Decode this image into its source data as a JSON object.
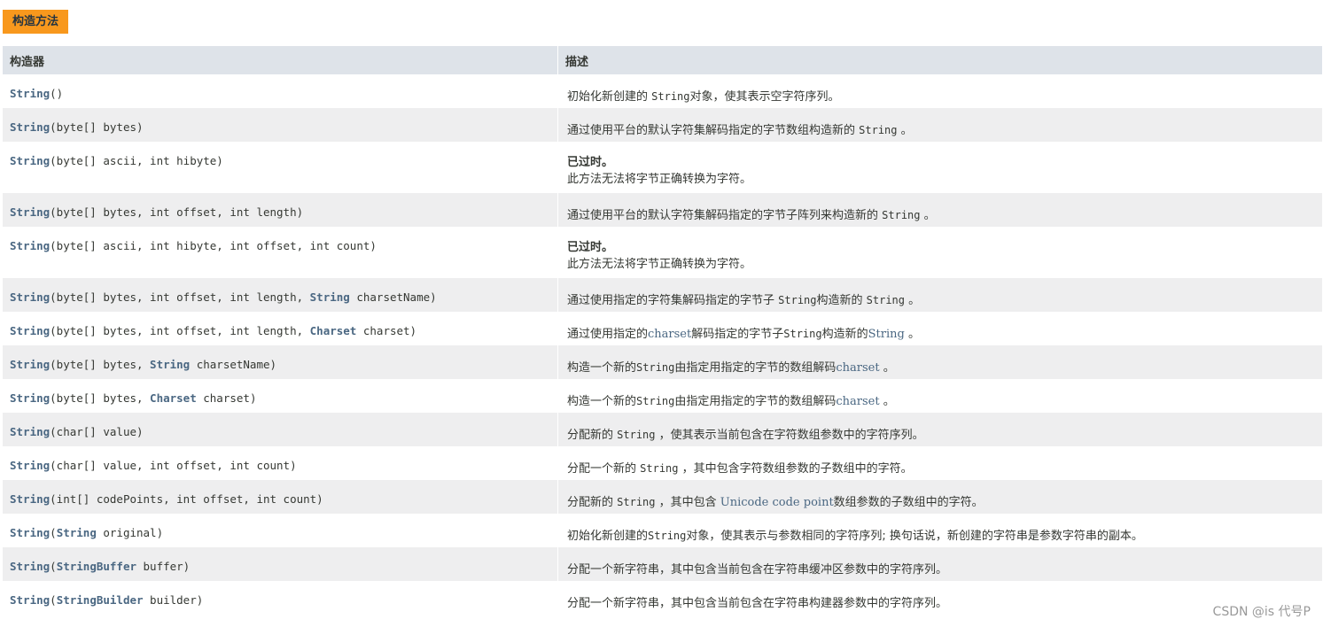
{
  "tab": {
    "label": "构造方法"
  },
  "table": {
    "headers": [
      "构造器",
      "描述"
    ],
    "rows": [
      {
        "sig": [
          {
            "t": "String",
            "l": true
          },
          {
            "t": "()"
          }
        ],
        "desc": [
          {
            "t": "初始化新创建的 "
          },
          {
            "t": "String",
            "m": true
          },
          {
            "t": "对象，使其表示空字符序列。"
          }
        ]
      },
      {
        "sig": [
          {
            "t": "String",
            "l": true
          },
          {
            "t": "(byte[] bytes)"
          }
        ],
        "desc": [
          {
            "t": "通过使用平台的默认字符集解码指定的字节数组构造新的 "
          },
          {
            "t": "String",
            "m": true
          },
          {
            "t": " 。"
          }
        ]
      },
      {
        "sig": [
          {
            "t": "String",
            "l": true
          },
          {
            "t": "(byte[] ascii, int hibyte)"
          }
        ],
        "deprecated": "已过时。",
        "desc": [
          {
            "t": "此方法无法将字节正确转换为字符。"
          }
        ]
      },
      {
        "sig": [
          {
            "t": "String",
            "l": true
          },
          {
            "t": "(byte[] bytes, int offset, int length)"
          }
        ],
        "desc": [
          {
            "t": "通过使用平台的默认字符集解码指定的字节子阵列来构造新的 "
          },
          {
            "t": "String",
            "m": true
          },
          {
            "t": " 。"
          }
        ]
      },
      {
        "sig": [
          {
            "t": "String",
            "l": true
          },
          {
            "t": "(byte[] ascii, int hibyte, int offset, int count)"
          }
        ],
        "deprecated": "已过时。",
        "desc": [
          {
            "t": "此方法无法将字节正确转换为字符。"
          }
        ]
      },
      {
        "sig": [
          {
            "t": "String",
            "l": true
          },
          {
            "t": "(byte[] bytes, int offset, int length, "
          },
          {
            "t": "String",
            "l": true
          },
          {
            "t": " charsetName)"
          }
        ],
        "desc": [
          {
            "t": "通过使用指定的字符集解码指定的字节子 "
          },
          {
            "t": "String",
            "m": true
          },
          {
            "t": "构造新的 "
          },
          {
            "t": "String",
            "m": true
          },
          {
            "t": " 。"
          }
        ]
      },
      {
        "sig": [
          {
            "t": "String",
            "l": true
          },
          {
            "t": "(byte[] bytes, int offset, int length, "
          },
          {
            "t": "Charset",
            "l": true
          },
          {
            "t": " charset)"
          }
        ],
        "desc": [
          {
            "t": "通过使用指定的"
          },
          {
            "t": "charset",
            "b": true
          },
          {
            "t": "解码指定的字节子"
          },
          {
            "t": "String",
            "m": true
          },
          {
            "t": "构造新的"
          },
          {
            "t": "String",
            "b": true
          },
          {
            "t": " 。"
          }
        ]
      },
      {
        "sig": [
          {
            "t": "String",
            "l": true
          },
          {
            "t": "(byte[] bytes, "
          },
          {
            "t": "String",
            "l": true
          },
          {
            "t": " charsetName)"
          }
        ],
        "desc": [
          {
            "t": "构造一个新的"
          },
          {
            "t": "String",
            "m": true
          },
          {
            "t": "由指定用指定的字节的数组解码"
          },
          {
            "t": "charset",
            "b": true
          },
          {
            "t": " 。"
          }
        ]
      },
      {
        "sig": [
          {
            "t": "String",
            "l": true
          },
          {
            "t": "(byte[] bytes, "
          },
          {
            "t": "Charset",
            "l": true
          },
          {
            "t": " charset)"
          }
        ],
        "desc": [
          {
            "t": "构造一个新的"
          },
          {
            "t": "String",
            "m": true
          },
          {
            "t": "由指定用指定的字节的数组解码"
          },
          {
            "t": "charset",
            "b": true
          },
          {
            "t": " 。"
          }
        ]
      },
      {
        "sig": [
          {
            "t": "String",
            "l": true
          },
          {
            "t": "(char[] value)"
          }
        ],
        "desc": [
          {
            "t": "分配新的 "
          },
          {
            "t": "String",
            "m": true
          },
          {
            "t": " ，使其表示当前包含在字符数组参数中的字符序列。"
          }
        ]
      },
      {
        "sig": [
          {
            "t": "String",
            "l": true
          },
          {
            "t": "(char[] value, int offset, int count)"
          }
        ],
        "desc": [
          {
            "t": "分配一个新的 "
          },
          {
            "t": "String",
            "m": true
          },
          {
            "t": " ，其中包含字符数组参数的子数组中的字符。"
          }
        ]
      },
      {
        "sig": [
          {
            "t": "String",
            "l": true
          },
          {
            "t": "(int[] codePoints, int offset, int count)"
          }
        ],
        "desc": [
          {
            "t": "分配新的 "
          },
          {
            "t": "String",
            "m": true
          },
          {
            "t": " ，其中包含 "
          },
          {
            "t": "Unicode code point",
            "b": true
          },
          {
            "t": "数组参数的子数组中的字符。"
          }
        ]
      },
      {
        "sig": [
          {
            "t": "String",
            "l": true
          },
          {
            "t": "("
          },
          {
            "t": "String",
            "l": true
          },
          {
            "t": " original)"
          }
        ],
        "desc": [
          {
            "t": "初始化新创建的"
          },
          {
            "t": "String",
            "m": true
          },
          {
            "t": "对象，使其表示与参数相同的字符序列; 换句话说，新创建的字符串是参数字符串的副本。"
          }
        ]
      },
      {
        "sig": [
          {
            "t": "String",
            "l": true
          },
          {
            "t": "("
          },
          {
            "t": "StringBuffer",
            "l": true
          },
          {
            "t": " buffer)"
          }
        ],
        "desc": [
          {
            "t": "分配一个新字符串，其中包含当前包含在字符串缓冲区参数中的字符序列。"
          }
        ]
      },
      {
        "sig": [
          {
            "t": "String",
            "l": true
          },
          {
            "t": "("
          },
          {
            "t": "StringBuilder",
            "l": true
          },
          {
            "t": " builder)"
          }
        ],
        "desc": [
          {
            "t": "分配一个新字符串，其中包含当前包含在字符串构建器参数中的字符序列。"
          }
        ]
      }
    ]
  },
  "watermark": "CSDN @is 代号P",
  "colors": {
    "tab_bg": "#f8981d",
    "header_bg": "#dee3e9",
    "alt_row_bg": "#eeeeef",
    "link": "#4a6782"
  }
}
